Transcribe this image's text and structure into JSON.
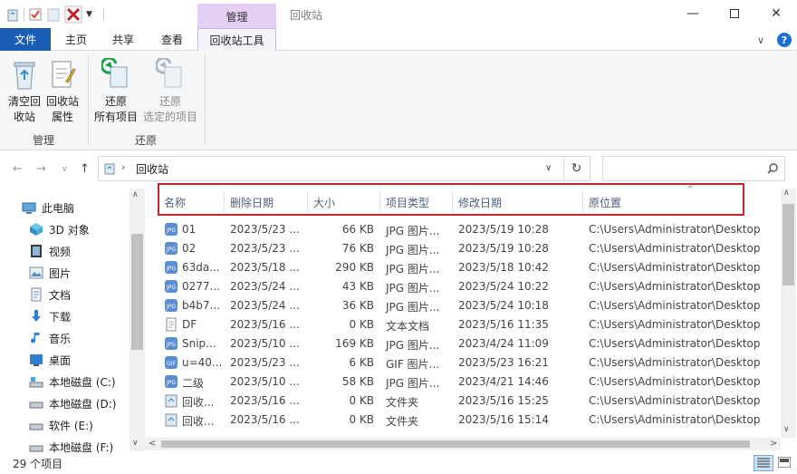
{
  "window": {
    "context_tab": "管理",
    "title": "回收站"
  },
  "ribbon_tabs": {
    "file": "文件",
    "home": "主页",
    "share": "共享",
    "view": "查看",
    "recycle_tools": "回收站工具"
  },
  "ribbon": {
    "empty_line1": "清空回",
    "empty_line2": "收站",
    "props_line1": "回收站",
    "props_line2": "属性",
    "manage_group": "管理",
    "restore_all_line1": "还原",
    "restore_all_line2": "所有项目",
    "restore_sel_line1": "还原",
    "restore_sel_line2": "选定的项目",
    "restore_group": "还原"
  },
  "address": {
    "path": "回收站"
  },
  "nav_pane": [
    {
      "label": "此电脑",
      "icon": "pc-icon"
    },
    {
      "label": "3D 对象",
      "icon": "3d-objects-icon"
    },
    {
      "label": "视频",
      "icon": "video-icon"
    },
    {
      "label": "图片",
      "icon": "pictures-icon"
    },
    {
      "label": "文档",
      "icon": "documents-icon"
    },
    {
      "label": "下载",
      "icon": "download-icon"
    },
    {
      "label": "音乐",
      "icon": "music-icon"
    },
    {
      "label": "桌面",
      "icon": "desktop-icon"
    },
    {
      "label": "本地磁盘 (C:)",
      "icon": "drive-icon"
    },
    {
      "label": "本地磁盘 (D:)",
      "icon": "drive-icon"
    },
    {
      "label": "软件 (E:)",
      "icon": "drive-icon"
    },
    {
      "label": "本地磁盘 (F:)",
      "icon": "drive-icon"
    }
  ],
  "columns": [
    "名称",
    "删除日期",
    "大小",
    "项目类型",
    "修改日期",
    "原位置"
  ],
  "files": [
    {
      "name": "01",
      "deleted": "2023/5/23 ...",
      "size": "66 KB",
      "type": "JPG 图片...",
      "modified": "2023/5/19 10:28",
      "location": "C:\\Users\\Administrator\\Desktop",
      "icon": "jpg-icon"
    },
    {
      "name": "02",
      "deleted": "2023/5/23 ...",
      "size": "76 KB",
      "type": "JPG 图片...",
      "modified": "2023/5/19 10:28",
      "location": "C:\\Users\\Administrator\\Desktop",
      "icon": "jpg-icon"
    },
    {
      "name": "63da...",
      "deleted": "2023/5/18 ...",
      "size": "290 KB",
      "type": "JPG 图片...",
      "modified": "2023/5/18 10:42",
      "location": "C:\\Users\\Administrator\\Desktop",
      "icon": "jpg-icon"
    },
    {
      "name": "0277...",
      "deleted": "2023/5/24 ...",
      "size": "43 KB",
      "type": "JPG 图片...",
      "modified": "2023/5/24 10:22",
      "location": "C:\\Users\\Administrator\\Desktop",
      "icon": "jpg-icon"
    },
    {
      "name": "b4b7...",
      "deleted": "2023/5/24 ...",
      "size": "36 KB",
      "type": "JPG 图片...",
      "modified": "2023/5/24 10:18",
      "location": "C:\\Users\\Administrator\\Desktop",
      "icon": "jpg-icon"
    },
    {
      "name": "DF",
      "deleted": "2023/5/16 ...",
      "size": "0 KB",
      "type": "文本文档",
      "modified": "2023/5/16 11:35",
      "location": "C:\\Users\\Administrator\\Desktop",
      "icon": "text-file-icon"
    },
    {
      "name": "Snip...",
      "deleted": "2023/5/10 ...",
      "size": "169 KB",
      "type": "JPG 图片...",
      "modified": "2023/4/24 11:09",
      "location": "C:\\Users\\Administrator\\Desktop",
      "icon": "jpg-icon"
    },
    {
      "name": "u=40...",
      "deleted": "2023/5/23 ...",
      "size": "6 KB",
      "type": "GIF 图片...",
      "modified": "2023/5/23 16:21",
      "location": "C:\\Users\\Administrator\\Desktop",
      "icon": "gif-icon"
    },
    {
      "name": "二级",
      "deleted": "2023/5/10 ...",
      "size": "58 KB",
      "type": "JPG 图片...",
      "modified": "2023/4/21 14:46",
      "location": "C:\\Users\\Administrator\\Desktop",
      "icon": "jpg-icon"
    },
    {
      "name": "回收...",
      "deleted": "2023/5/16 ...",
      "size": "0 KB",
      "type": "文件夹",
      "modified": "2023/5/16 15:25",
      "location": "C:\\Users\\Administrator\\Desktop",
      "icon": "recycle-folder-icon"
    },
    {
      "name": "回收...",
      "deleted": "2023/5/16 ...",
      "size": "0 KB",
      "type": "文件夹",
      "modified": "2023/5/16 15:14",
      "location": "C:\\Users\\Administrator\\Desktop",
      "icon": "recycle-folder-icon"
    }
  ],
  "status": {
    "count": "29 个项目"
  },
  "colors": {
    "file_tab": "#1a5fb4",
    "context_tab": "#e5cff5",
    "highlight_box": "#c0272d"
  }
}
